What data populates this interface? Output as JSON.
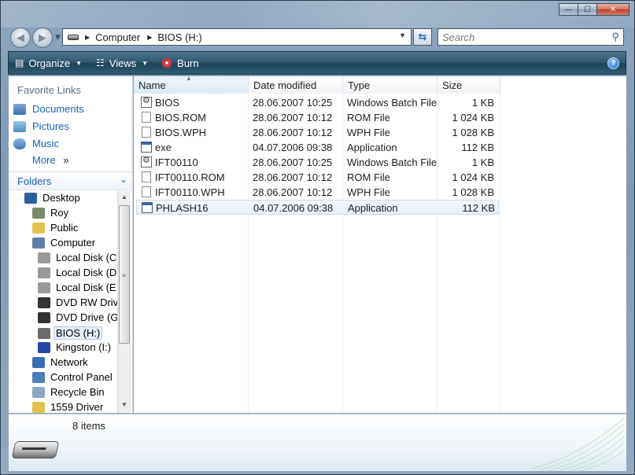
{
  "window": {
    "caption_buttons": {
      "minimize": "—",
      "maximize": "☐",
      "close": "✕"
    }
  },
  "address": {
    "crumbs": [
      "Computer",
      "BIOS (H:)"
    ],
    "search_placeholder": "Search"
  },
  "toolbar": {
    "organize": "Organize",
    "views": "Views",
    "burn": "Burn",
    "help": "?"
  },
  "favorites": {
    "header": "Favorite Links",
    "items": [
      {
        "label": "Documents",
        "icon": "documents-icon"
      },
      {
        "label": "Pictures",
        "icon": "pictures-icon"
      },
      {
        "label": "Music",
        "icon": "music-icon"
      }
    ],
    "more": "More",
    "more_chevron": "»"
  },
  "folders": {
    "header": "Folders",
    "tree": [
      {
        "label": "Desktop",
        "icon": "desktop-icon",
        "indent": 0,
        "color": "#2d5f9a"
      },
      {
        "label": "Roy",
        "icon": "user-folder-icon",
        "indent": 1,
        "color": "#7b8b6a"
      },
      {
        "label": "Public",
        "icon": "folder-icon",
        "indent": 1,
        "color": "#e1c24d"
      },
      {
        "label": "Computer",
        "icon": "computer-icon",
        "indent": 1,
        "color": "#5f7fa6"
      },
      {
        "label": "Local Disk (C:)",
        "icon": "system-drive-icon",
        "indent": 2,
        "color": "#9a9a9a"
      },
      {
        "label": "Local Disk (D:)",
        "icon": "hard-drive-icon",
        "indent": 2,
        "color": "#9a9a9a"
      },
      {
        "label": "Local Disk (E:)",
        "icon": "hard-drive-icon",
        "indent": 2,
        "color": "#9a9a9a"
      },
      {
        "label": "DVD RW Drive",
        "icon": "dvd-rw-icon",
        "indent": 2,
        "color": "#333333"
      },
      {
        "label": "DVD Drive (G:)",
        "icon": "dvd-drive-icon",
        "indent": 2,
        "color": "#333333"
      },
      {
        "label": "BIOS (H:)",
        "icon": "removable-drive-icon",
        "indent": 2,
        "color": "#6a6a6a",
        "selected": true
      },
      {
        "label": "Kingston (I:)",
        "icon": "usb-drive-icon",
        "indent": 2,
        "color": "#2846a8"
      },
      {
        "label": "Network",
        "icon": "network-icon",
        "indent": 1,
        "color": "#3a6fb4"
      },
      {
        "label": "Control Panel",
        "icon": "control-panel-icon",
        "indent": 1,
        "color": "#4f7db8"
      },
      {
        "label": "Recycle Bin",
        "icon": "recycle-bin-icon",
        "indent": 1,
        "color": "#8fa8c4"
      },
      {
        "label": "1559 Driver",
        "icon": "folder-icon",
        "indent": 1,
        "color": "#e1c24d"
      }
    ]
  },
  "file_list": {
    "columns": [
      "Name",
      "Date modified",
      "Type",
      "Size"
    ],
    "sort_indicator": "▲",
    "rows": [
      {
        "name": "BIOS",
        "date": "28.06.2007 10:25",
        "type": "Windows Batch File",
        "size": "1 KB",
        "icon": "batch"
      },
      {
        "name": "BIOS.ROM",
        "date": "28.06.2007 10:12",
        "type": "ROM File",
        "size": "1 024 KB",
        "icon": "doc"
      },
      {
        "name": "BIOS.WPH",
        "date": "28.06.2007 10:12",
        "type": "WPH File",
        "size": "1 028 KB",
        "icon": "doc"
      },
      {
        "name": "exe",
        "date": "04.07.2006 09:38",
        "type": "Application",
        "size": "112 KB",
        "icon": "app"
      },
      {
        "name": "IFT00110",
        "date": "28.06.2007 10:25",
        "type": "Windows Batch File",
        "size": "1 KB",
        "icon": "batch"
      },
      {
        "name": "IFT00110.ROM",
        "date": "28.06.2007 10:12",
        "type": "ROM File",
        "size": "1 024 KB",
        "icon": "doc"
      },
      {
        "name": "IFT00110.WPH",
        "date": "28.06.2007 10:12",
        "type": "WPH File",
        "size": "1 028 KB",
        "icon": "doc"
      },
      {
        "name": "PHLASH16",
        "date": "04.07.2006 09:38",
        "type": "Application",
        "size": "112 KB",
        "icon": "app",
        "selected": true
      }
    ]
  },
  "details": {
    "count": "8 items"
  }
}
